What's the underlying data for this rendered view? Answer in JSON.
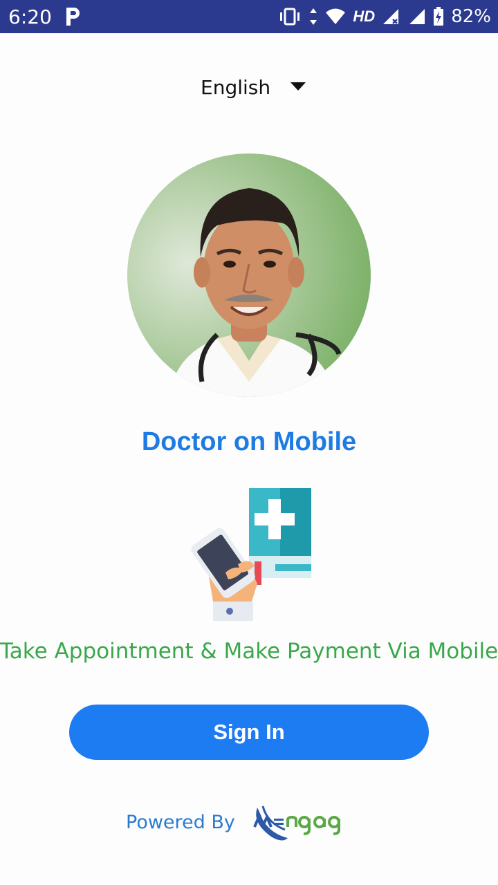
{
  "status_bar": {
    "time": "6:20",
    "network_label": "HD",
    "battery_percent": "82%"
  },
  "language_selector": {
    "selected": "English"
  },
  "app": {
    "title": "Doctor on Mobile",
    "tagline": "Take Appointment & Make Payment Via Mobile"
  },
  "actions": {
    "sign_in_label": "Sign In"
  },
  "footer": {
    "powered_by_label": "Powered By",
    "brand_logo_text": "MENGAGE"
  },
  "colors": {
    "status_bar": "#2b3a8f",
    "title": "#1e7be3",
    "tagline": "#3aa84a",
    "primary_button": "#1e7cf2",
    "powered_by": "#2a7bd0"
  }
}
